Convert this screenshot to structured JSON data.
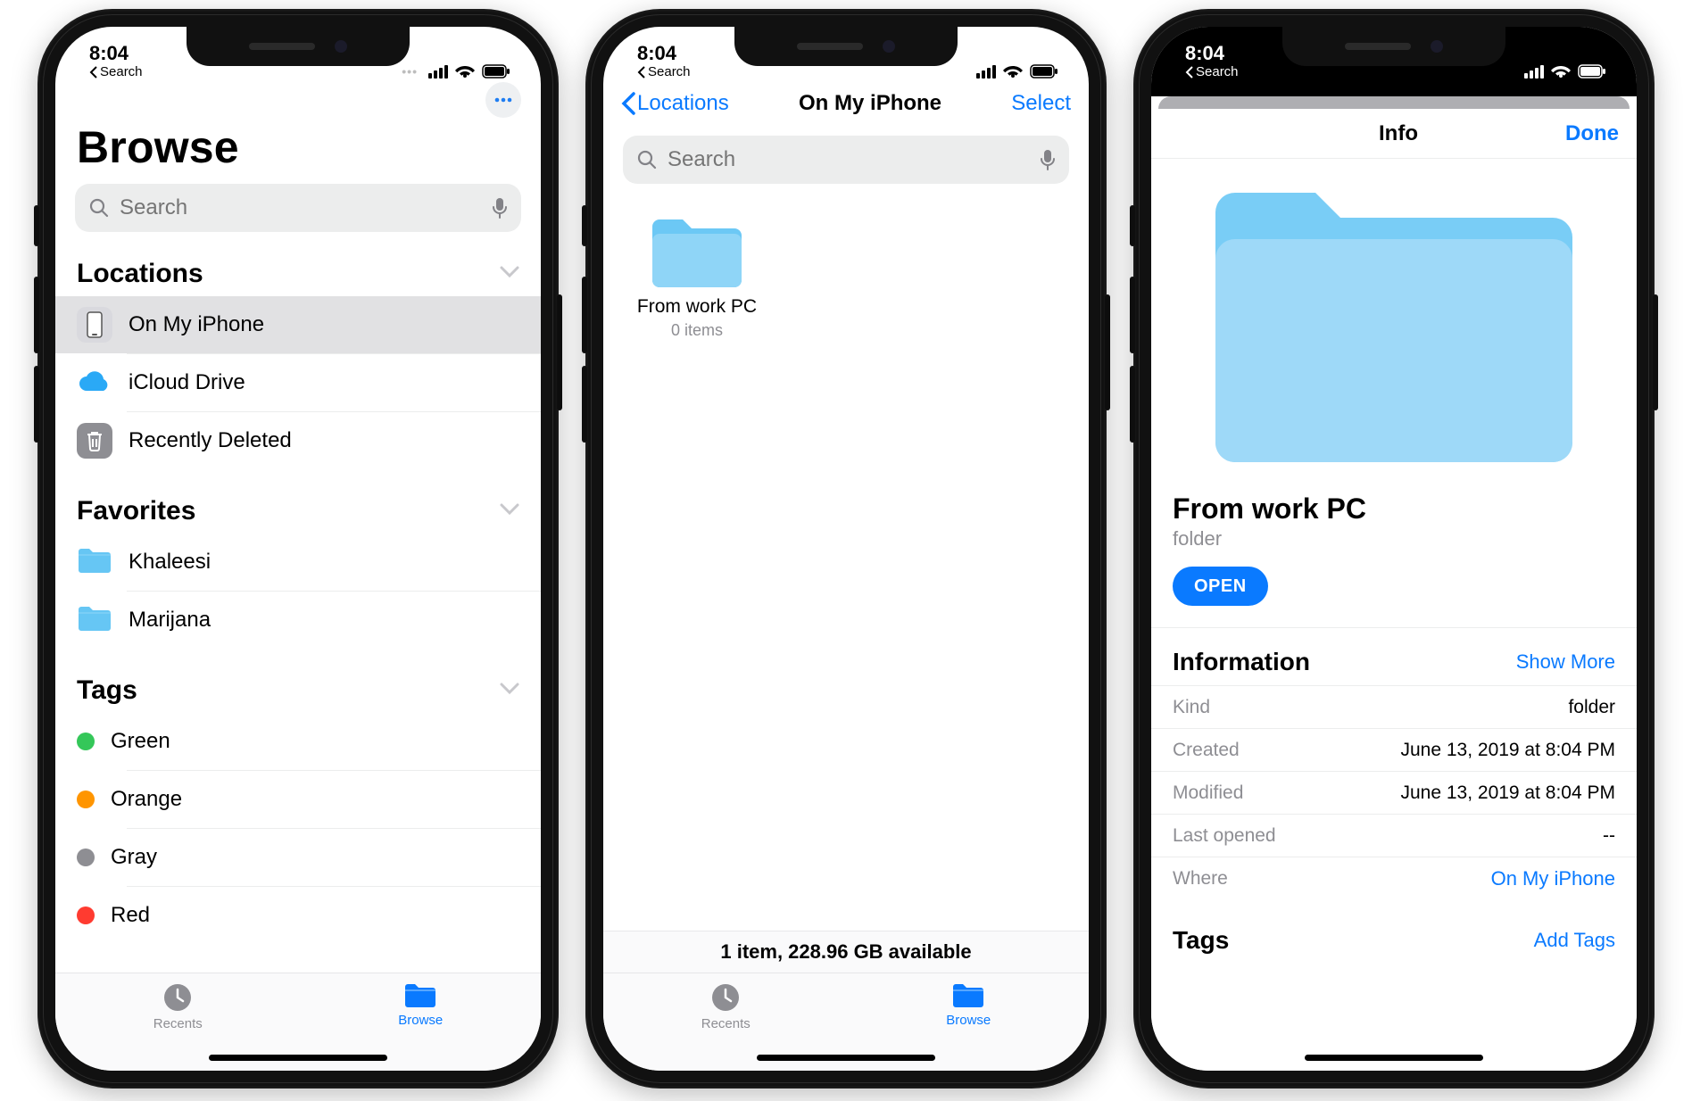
{
  "status": {
    "time": "8:04",
    "backLabel": "Search"
  },
  "screen1": {
    "title": "Browse",
    "searchPlaceholder": "Search",
    "sections": {
      "locationsLabel": "Locations",
      "favoritesLabel": "Favorites",
      "tagsLabel": "Tags"
    },
    "locations": [
      {
        "label": "On My iPhone"
      },
      {
        "label": "iCloud Drive"
      },
      {
        "label": "Recently Deleted"
      }
    ],
    "favorites": [
      {
        "label": "Khaleesi"
      },
      {
        "label": "Marijana"
      }
    ],
    "tags": [
      {
        "label": "Green",
        "color": "#34c759"
      },
      {
        "label": "Orange",
        "color": "#ff9500"
      },
      {
        "label": "Gray",
        "color": "#8e8e93"
      },
      {
        "label": "Red",
        "color": "#ff3b30"
      }
    ],
    "tabs": {
      "recents": "Recents",
      "browse": "Browse"
    }
  },
  "screen2": {
    "backLabel": "Locations",
    "title": "On My iPhone",
    "select": "Select",
    "searchPlaceholder": "Search",
    "folder": {
      "name": "From work PC",
      "sub": "0 items"
    },
    "footer": "1 item, 228.96 GB available",
    "tabs": {
      "recents": "Recents",
      "browse": "Browse"
    }
  },
  "screen3": {
    "navTitle": "Info",
    "done": "Done",
    "name": "From work PC",
    "kind": "folder",
    "open": "OPEN",
    "informationLabel": "Information",
    "showMore": "Show More",
    "rows": {
      "kindLabel": "Kind",
      "kindValue": "folder",
      "createdLabel": "Created",
      "createdValue": "June 13, 2019 at 8:04 PM",
      "modifiedLabel": "Modified",
      "modifiedValue": "June 13, 2019 at 8:04 PM",
      "lastOpenedLabel": "Last opened",
      "lastOpenedValue": "--",
      "whereLabel": "Where",
      "whereValue": "On My iPhone"
    },
    "tagsLabel": "Tags",
    "addTags": "Add Tags"
  }
}
